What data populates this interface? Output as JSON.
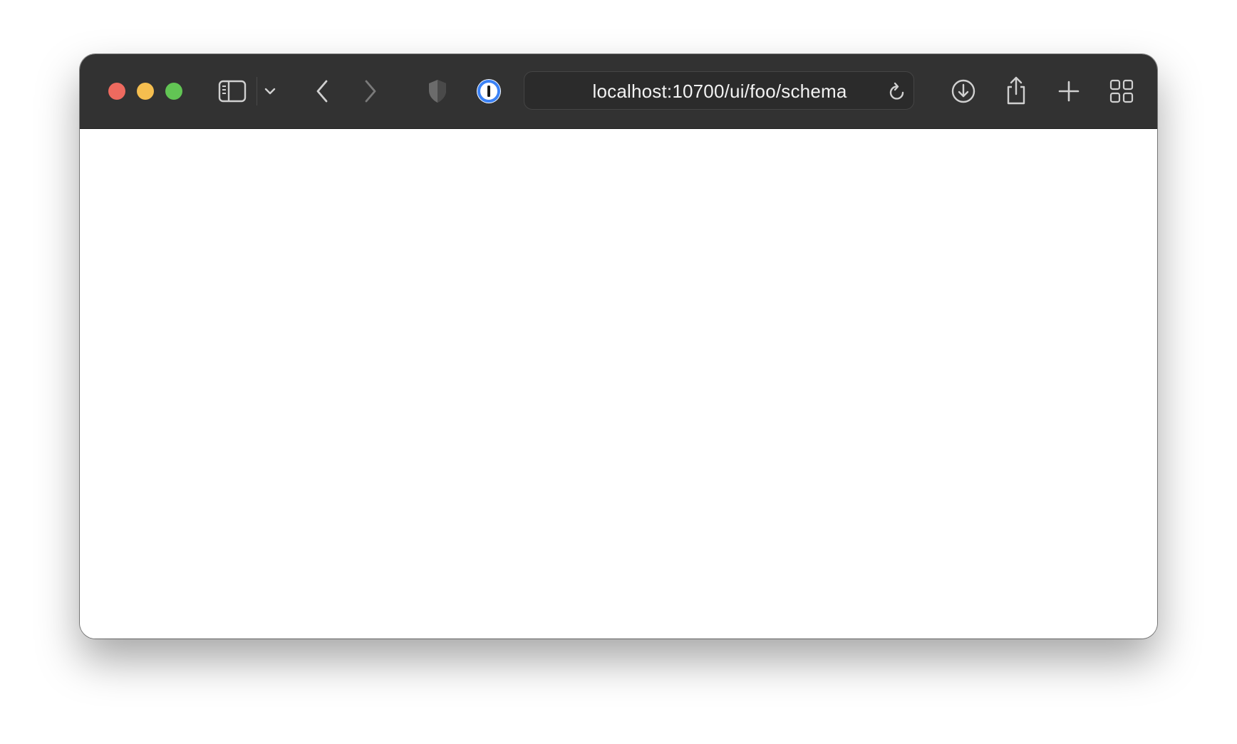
{
  "colors": {
    "toolbar_bg": "#323232",
    "close": "#ee6a5f",
    "minimize": "#f5be4f",
    "maximize": "#62c554",
    "icon": "#d0d0d0",
    "icon_dim": "#7a7a7a",
    "accent_blue": "#3b82f6"
  },
  "toolbar": {
    "icons": {
      "sidebar": "sidebar-icon",
      "sidebar_menu": "chevron-down-icon",
      "back": "chevron-left-icon",
      "forward": "chevron-right-icon",
      "privacy": "shield-icon",
      "password_manager": "1password-icon",
      "reload": "reload-icon",
      "downloads": "download-icon",
      "share": "share-icon",
      "new_tab": "plus-icon",
      "tab_overview": "grid-icon"
    }
  },
  "address_bar": {
    "url": "localhost:10700/ui/foo/schema"
  }
}
